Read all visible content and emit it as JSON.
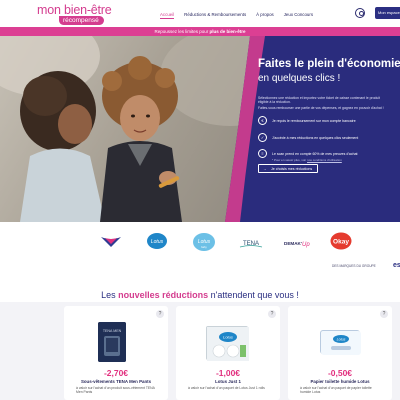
{
  "header": {
    "logo_main": "mon bien-être",
    "logo_sub": "récompensé",
    "nav": [
      {
        "label": "Accueil"
      },
      {
        "label": "Réductions & Remboursements"
      },
      {
        "label": "À propos"
      },
      {
        "label": "Jeux Concours"
      }
    ],
    "account_icon": "user-icon",
    "cta_label": "Mon espace"
  },
  "promo": {
    "text": "Repoussez les limites pour",
    "bold": "plus de bien-être"
  },
  "hero": {
    "title": "Faites le plein d'économies",
    "subtitle": "en quelques clics !",
    "paragraph": [
      "Sélectionnez une réduction et importez votre ticket de caisse contenant le produit",
      "éligible à la réduction.",
      "Faites-vous rembourser une partie de vos dépenses, et gagnez en pouvoir d'achat !"
    ],
    "steps": [
      {
        "icon": "money-icon",
        "text": "Je reçois le remboursement sur mon compte bancaire"
      },
      {
        "icon": "check-icon",
        "text": "J'accède à mes réductions en quelques clics seulement"
      },
      {
        "icon": "receipt-icon",
        "text": "Le scan prend en compte 60% de mes preuves d'achat"
      }
    ],
    "steps_note": "* Pour en savoir plus, voir",
    "steps_note_link": "nos conditions d'utilisation",
    "button_label": "Je choisis mes réductions",
    "button_icon": "arrow-icon"
  },
  "brands": {
    "items": [
      {
        "name": "Nana"
      },
      {
        "name": "Lotus"
      },
      {
        "name": "Lotus Baby"
      },
      {
        "name": "TENA"
      },
      {
        "name": "Demak'Up"
      },
      {
        "name": "Okay"
      }
    ],
    "note": "DES MARQUES DU GROUPE",
    "group_logo": "es"
  },
  "section": {
    "title_before": "Les",
    "title_bold": "nouvelles réductions",
    "title_after": "n'attendent que vous !"
  },
  "products": [
    {
      "price": "-2,70€",
      "name": "Sous-vêtements TENA Men Pants",
      "desc": "à valoir sur l'achat d'un produit sous-vêtement TENA Men Pants",
      "image": "TENA MEN"
    },
    {
      "price": "-1,00€",
      "name": "Lotus Just 1",
      "desc": "à valoir sur l'achat d'un paquet de Lotus Just 1 rolls",
      "image": "Lotus"
    },
    {
      "price": "-0,50€",
      "name": "Papier toilette humide Lotus",
      "desc": "à valoir sur l'achat d'un paquet de papier toilette humide Lotus",
      "image": "Lotus"
    }
  ],
  "colors": {
    "brand_pink": "#d43d8f",
    "navy": "#2b2f82",
    "price": "#e2307f"
  }
}
